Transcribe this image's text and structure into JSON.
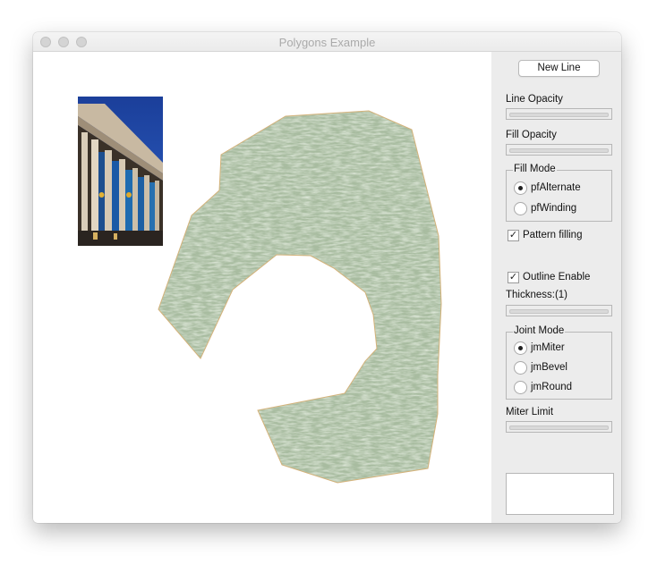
{
  "window": {
    "title": "Polygons Example"
  },
  "canvas": {
    "outline_color": "#d4b27a",
    "fill_color": "#a8bca0"
  },
  "panel": {
    "new_line_button": "New Line",
    "line_opacity_label": "Line Opacity",
    "fill_opacity_label": "Fill Opacity",
    "fill_mode": {
      "legend": "Fill Mode",
      "options": [
        {
          "label": "pfAlternate",
          "selected": true
        },
        {
          "label": "pfWinding",
          "selected": false
        }
      ]
    },
    "pattern_filling": {
      "label": "Pattern filling",
      "checked": true
    },
    "outline_enable": {
      "label": "Outline Enable",
      "checked": true
    },
    "thickness_label": "Thickness:(1)",
    "joint_mode": {
      "legend": "Joint Mode",
      "options": [
        {
          "label": "jmMiter",
          "selected": true
        },
        {
          "label": "jmBevel",
          "selected": false
        },
        {
          "label": "jmRound",
          "selected": false
        }
      ]
    },
    "miter_limit_label": "Miter Limit",
    "check_mark": "✓"
  }
}
